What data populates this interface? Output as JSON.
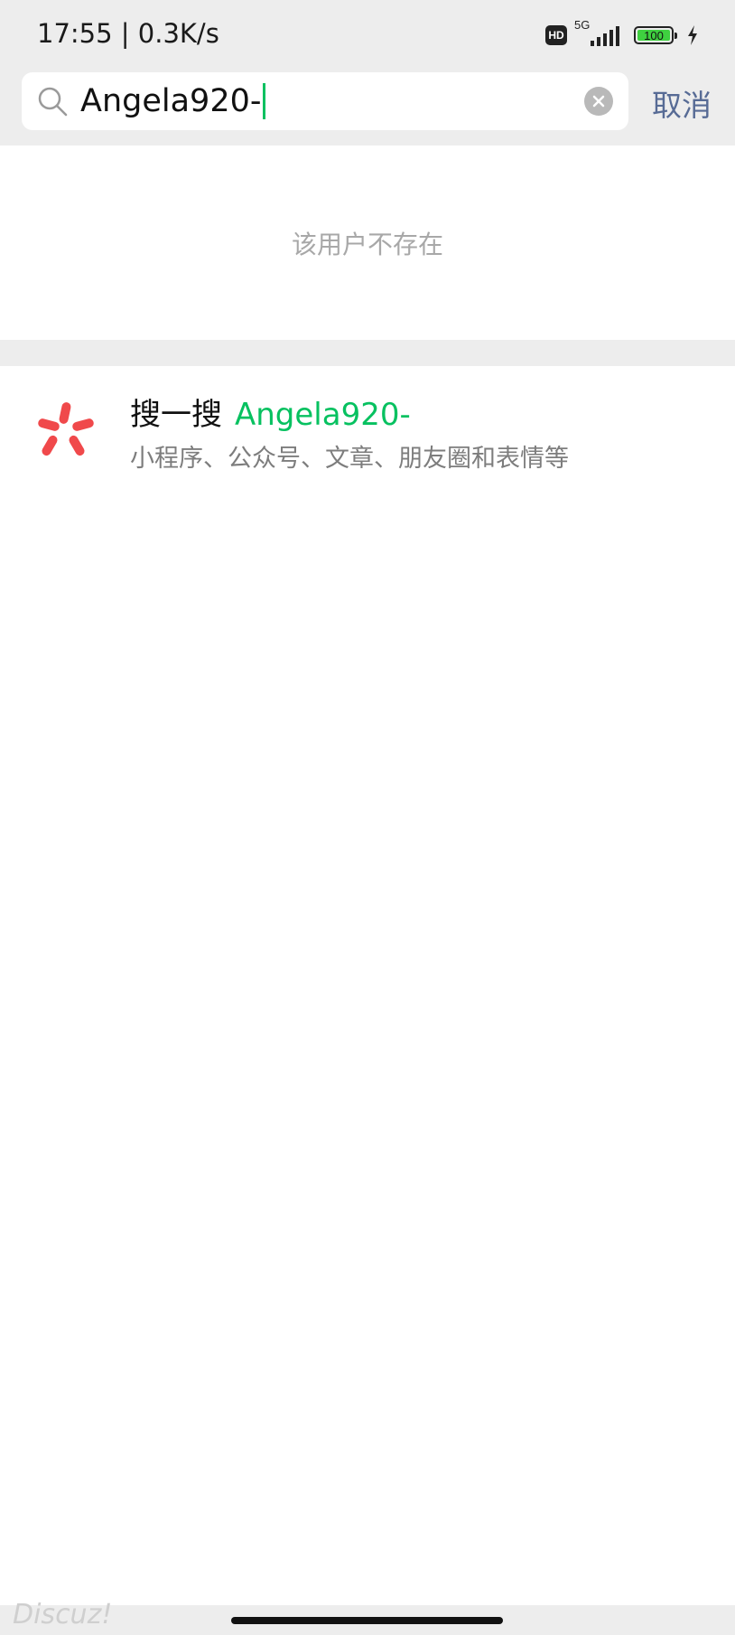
{
  "status_bar": {
    "time_speed": "17:55 | 0.3K/s",
    "hd_label": "HD",
    "network_label": "5G",
    "battery_level": "100",
    "icons": [
      "hd-icon",
      "signal-icon",
      "battery-icon",
      "charging-icon"
    ]
  },
  "search": {
    "query": "Angela920-",
    "cancel_label": "取消",
    "icons": [
      "search-icon",
      "clear-icon"
    ]
  },
  "result": {
    "not_found_message": "该用户不存在"
  },
  "sousuo": {
    "title": "搜一搜",
    "query": "Angela920-",
    "subtitle": "小程序、公众号、文章、朋友圈和表情等",
    "icon": "sousuo-icon"
  },
  "watermark": "Discuz!",
  "colors": {
    "accent_green": "#07c160",
    "link_blue": "#576b95",
    "background_gray": "#ededed",
    "brand_red": "#f0494b"
  }
}
